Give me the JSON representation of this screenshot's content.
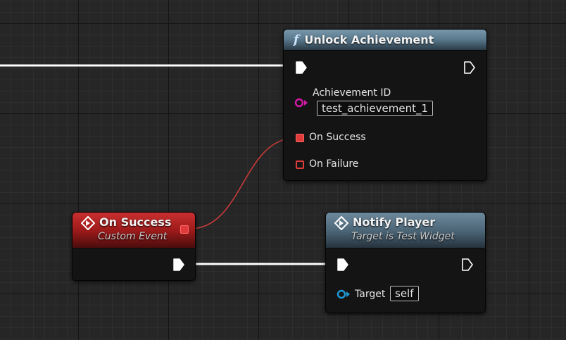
{
  "unlock_node": {
    "title": "Unlock Achievement",
    "function_icon": "f",
    "achievement_id_label": "Achievement ID",
    "achievement_id_value": "test_achievement_1",
    "on_success_label": "On Success",
    "on_failure_label": "On Failure"
  },
  "event_node": {
    "title": "On Success",
    "subtitle": "Custom Event"
  },
  "notify_node": {
    "title": "Notify Player",
    "subtitle": "Target is Test Widget",
    "target_label": "Target",
    "target_value": "self"
  },
  "colors": {
    "exec_wire": "#ffffff",
    "delegate_wire": "#c83a3a",
    "delegate_pin": "#e03a3a",
    "string_pin": "#d61aa8",
    "object_pin": "#1e9ad6",
    "function_header": "#5c7c90",
    "event_header": "#9e1b1b"
  }
}
